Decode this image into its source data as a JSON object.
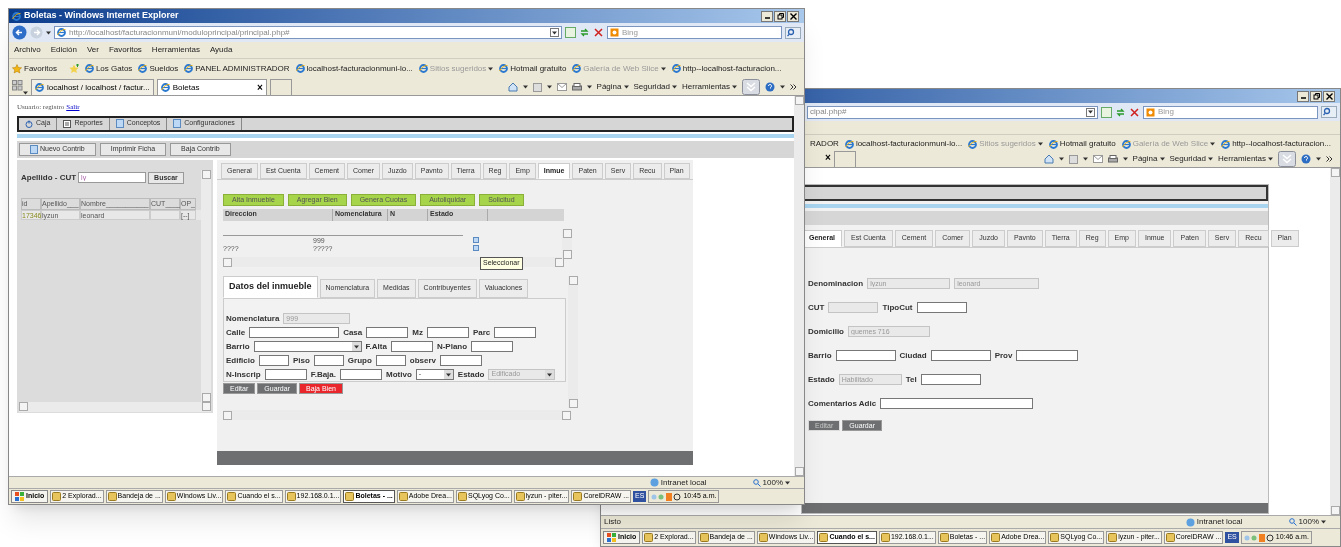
{
  "back_window": {
    "address": "cipal.php#",
    "search_placeholder": "Bing",
    "favorites": [
      {
        "label": "RADOR",
        "icon": false,
        "dimmed": false,
        "dropdown": false
      },
      {
        "label": "localhost-facturacionmuni-lo...",
        "icon": true,
        "dimmed": false,
        "dropdown": false
      },
      {
        "label": "Sitios sugeridos",
        "icon": true,
        "dimmed": true,
        "dropdown": true
      },
      {
        "label": "Hotmail gratuito",
        "icon": true,
        "dimmed": false,
        "dropdown": false
      },
      {
        "label": "Galería de Web Slice",
        "icon": true,
        "dimmed": true,
        "dropdown": true
      },
      {
        "label": "http--localhost-facturacion...",
        "icon": true,
        "dimmed": false,
        "dropdown": false
      }
    ],
    "tab_close": "×",
    "commands": [
      "Página",
      "Seguridad",
      "Herramientas"
    ],
    "page": {
      "section_tabs": [
        {
          "label": "General",
          "selected": true
        },
        {
          "label": "Est Cuenta",
          "selected": false
        },
        {
          "label": "Cement",
          "selected": false
        },
        {
          "label": "Comer",
          "selected": false
        },
        {
          "label": "Juzdo",
          "selected": false
        },
        {
          "label": "Pavnto",
          "selected": false
        },
        {
          "label": "Tierra",
          "selected": false
        },
        {
          "label": "Reg",
          "selected": false
        },
        {
          "label": "Emp",
          "selected": false
        },
        {
          "label": "Inmue",
          "selected": false
        },
        {
          "label": "Paten",
          "selected": false
        },
        {
          "label": "Serv",
          "selected": false
        },
        {
          "label": "Recu",
          "selected": false
        },
        {
          "label": "Plan",
          "selected": false
        }
      ],
      "form": [
        [
          {
            "label": "Denominacion",
            "kind": "input",
            "value": "lyzun",
            "disabled": true
          },
          {
            "kind": "input",
            "value": "leonard",
            "disabled": true
          }
        ],
        [
          {
            "label": "CUT",
            "kind": "input",
            "disabled": true
          },
          {
            "label": "TipoCut",
            "kind": "input",
            "disabled": false
          }
        ],
        [
          {
            "label": "Domicilio",
            "kind": "input",
            "value": "guemes 716",
            "disabled": true
          }
        ],
        [
          {
            "label": "Barrio",
            "kind": "input",
            "disabled": false
          },
          {
            "label": "Ciudad",
            "kind": "input",
            "disabled": false
          },
          {
            "label": "Prov",
            "kind": "input",
            "disabled": false
          }
        ],
        [
          {
            "label": "Estado",
            "kind": "input",
            "value": "Habilitado",
            "disabled": true
          },
          {
            "label": "Tel",
            "kind": "input",
            "disabled": false
          }
        ],
        [
          {
            "label": "Comentarios Adic",
            "kind": "input",
            "disabled": false
          }
        ]
      ],
      "buttons": [
        {
          "label": "Editar",
          "kind": "dark",
          "disabled": true
        },
        {
          "label": "Guardar",
          "kind": "dark",
          "disabled": false
        }
      ]
    },
    "status_bar": {
      "text": "Listo",
      "zone": "Intranet local",
      "zoom": "100%"
    },
    "taskbar": {
      "start": "Inicio",
      "items": [
        {
          "label": "2 Explorad...",
          "selected": false
        },
        {
          "label": "Bandeja de ...",
          "selected": false
        },
        {
          "label": "Windows Liv...",
          "selected": false
        },
        {
          "label": "Cuando el s...",
          "selected": true
        },
        {
          "label": "192.168.0.1...",
          "selected": false
        },
        {
          "label": "Boletas - ...",
          "selected": false
        },
        {
          "label": "Adobe Drea...",
          "selected": false
        },
        {
          "label": "SQLyog Co...",
          "selected": false
        },
        {
          "label": "lyzun - piter...",
          "selected": false
        },
        {
          "label": "CorelDRAW ...",
          "selected": false
        }
      ],
      "language": "ES",
      "clock": "10:46 a.m."
    }
  },
  "front_window": {
    "title": "Boletas - Windows Internet Explorer",
    "address": "http://localhost/facturacionmuni/moduloprincipal/principal.php#",
    "search_placeholder": "Bing",
    "menu": [
      "Archivo",
      "Edición",
      "Ver",
      "Favoritos",
      "Herramientas",
      "Ayuda"
    ],
    "favorites_label": "Favoritos",
    "favorites": [
      {
        "label": "Los Gatos",
        "icon": true,
        "dimmed": false,
        "dropdown": false
      },
      {
        "label": "Sueldos",
        "icon": true,
        "dimmed": false,
        "dropdown": false
      },
      {
        "label": "PANEL ADMINISTRADOR",
        "icon": true,
        "dimmed": false,
        "dropdown": false
      },
      {
        "label": "localhost-facturacionmuni-lo...",
        "icon": true,
        "dimmed": false,
        "dropdown": false
      },
      {
        "label": "Sitios sugeridos",
        "icon": true,
        "dimmed": true,
        "dropdown": true
      },
      {
        "label": "Hotmail gratuito",
        "icon": true,
        "dimmed": false,
        "dropdown": false
      },
      {
        "label": "Galería de Web Slice",
        "icon": true,
        "dimmed": true,
        "dropdown": true
      },
      {
        "label": "http--localhost-facturacion...",
        "icon": true,
        "dimmed": false,
        "dropdown": false
      }
    ],
    "tabs": [
      {
        "label": "localhost / localhost / factur...",
        "selected": false
      },
      {
        "label": "Boletas",
        "selected": true
      }
    ],
    "tab_close": "×",
    "commands": [
      "Página",
      "Seguridad",
      "Herramientas"
    ],
    "page": {
      "user_label": "Usuario: registro",
      "logout_link": "Salir",
      "nav": [
        "Caja",
        "Reportes",
        "Conceptos",
        "Configuraciones"
      ],
      "actions": [
        "Nuevo Contrib",
        "Imprimir Ficha",
        "Baja Contrib"
      ],
      "search": {
        "label": "Apellido - CUT",
        "value": "ly",
        "button": "Buscar"
      },
      "results": {
        "columns": [
          "id",
          "Apellido___",
          "Nombre___________",
          "CUT____",
          "OP_"
        ],
        "rows": [
          {
            "id": "17346",
            "apellido": "lyzun",
            "nombre": "leonard",
            "op": "[--]"
          }
        ]
      },
      "section_tabs": [
        {
          "label": "General",
          "selected": false
        },
        {
          "label": "Est Cuenta",
          "selected": false
        },
        {
          "label": "Cement",
          "selected": false
        },
        {
          "label": "Comer",
          "selected": false
        },
        {
          "label": "Juzdo",
          "selected": false
        },
        {
          "label": "Pavnto",
          "selected": false
        },
        {
          "label": "Tierra",
          "selected": false
        },
        {
          "label": "Reg",
          "selected": false
        },
        {
          "label": "Emp",
          "selected": false
        },
        {
          "label": "Inmue",
          "selected": true
        },
        {
          "label": "Paten",
          "selected": false
        },
        {
          "label": "Serv",
          "selected": false
        },
        {
          "label": "Recu",
          "selected": false
        },
        {
          "label": "Plan",
          "selected": false
        }
      ],
      "inmueble_buttons": [
        "Alta Inmueble",
        "Agregar Bien",
        "Genera Cuotas",
        "Autoliquidar",
        "Solicitud"
      ],
      "grid": {
        "columns": [
          "Direccion",
          "Nomenclatura",
          "N",
          "Estado"
        ],
        "rows": [
          {
            "nomenclatura": "999"
          },
          {
            "direccion": "????",
            "nomenclatura": "?????"
          }
        ],
        "tooltip": "Seleccionar"
      },
      "detail_tabs": [
        {
          "label": "Datos del inmueble",
          "selected": true
        },
        {
          "label": "Nomenclatura",
          "selected": false
        },
        {
          "label": "Medidas",
          "selected": false
        },
        {
          "label": "Contribuyentes",
          "selected": false
        },
        {
          "label": "Valuaciones",
          "selected": false
        }
      ],
      "form": [
        [
          {
            "label": "Nomenclatura",
            "kind": "input",
            "value": "999",
            "disabled": true
          }
        ],
        [
          {
            "label": "Calle",
            "kind": "input",
            "disabled": false
          },
          {
            "label": "Casa",
            "kind": "input",
            "disabled": false
          },
          {
            "label": "Mz",
            "kind": "input",
            "disabled": false
          },
          {
            "label": "Parc",
            "kind": "input",
            "disabled": false
          }
        ],
        [
          {
            "label": "Barrio",
            "kind": "select",
            "disabled": false
          },
          {
            "label": "F.Alta",
            "kind": "input",
            "disabled": false
          },
          {
            "label": "N-Plano",
            "kind": "input",
            "disabled": false
          }
        ],
        [
          {
            "label": "Edificio",
            "kind": "input",
            "disabled": false
          },
          {
            "label": "Piso",
            "kind": "input",
            "disabled": false
          },
          {
            "label": "Grupo",
            "kind": "input",
            "disabled": false
          },
          {
            "label": "observ",
            "kind": "input",
            "disabled": false
          }
        ],
        [
          {
            "label": "N-Inscrip",
            "kind": "input",
            "disabled": false
          },
          {
            "label": "F.Baja.",
            "kind": "input",
            "disabled": false
          },
          {
            "label": "Motivo",
            "kind": "select",
            "value": "-",
            "disabled": false
          },
          {
            "label": "Estado",
            "kind": "select",
            "value": "Edificado",
            "disabled": true
          }
        ]
      ],
      "buttons": [
        {
          "label": "Editar",
          "kind": "dark",
          "disabled": false
        },
        {
          "label": "Guardar",
          "kind": "dark",
          "disabled": false
        },
        {
          "label": "Baja Bien",
          "kind": "danger",
          "disabled": false
        }
      ]
    },
    "status_bar": {
      "zone": "Intranet local",
      "zoom": "100%"
    },
    "taskbar": {
      "start": "Inicio",
      "items": [
        {
          "label": "2 Explorad...",
          "selected": false
        },
        {
          "label": "Bandeja de ...",
          "selected": false
        },
        {
          "label": "Windows Liv...",
          "selected": false
        },
        {
          "label": "Cuando el s...",
          "selected": false
        },
        {
          "label": "192.168.0.1...",
          "selected": false
        },
        {
          "label": "Boletas - ...",
          "selected": true
        },
        {
          "label": "Adobe Drea...",
          "selected": false
        },
        {
          "label": "SQLyog Co...",
          "selected": false
        },
        {
          "label": "lyzun - piter...",
          "selected": false
        },
        {
          "label": "CorelDRAW ...",
          "selected": false
        }
      ],
      "language": "ES",
      "clock": "10:45 a.m."
    }
  }
}
